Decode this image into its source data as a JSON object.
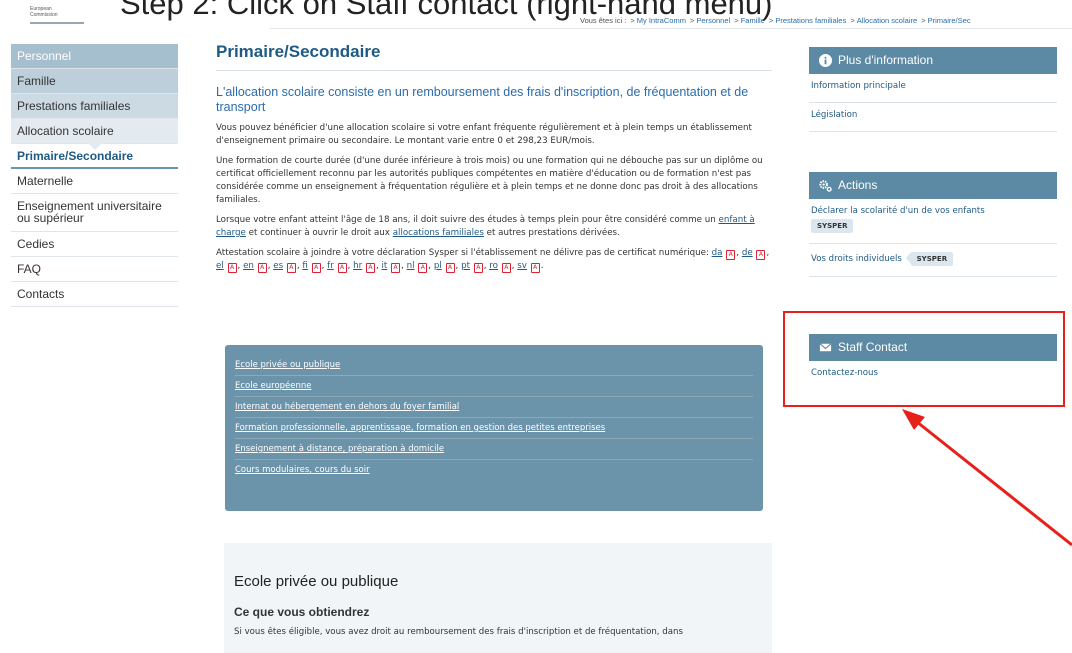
{
  "overlay_caption": "Step 2: Click on Staff contact (right-hand menu)",
  "logo": {
    "line1": "European",
    "line2": "Commission"
  },
  "breadcrumb": {
    "prefix": "Vous êtes ici :",
    "items": [
      "My IntraComm",
      "Personnel",
      "Famille",
      "Prestations familiales",
      "Allocation scolaire",
      "Primaire/Sec"
    ]
  },
  "sidebar": {
    "items": [
      {
        "label": "Personnel"
      },
      {
        "label": "Famille"
      },
      {
        "label": "Prestations familiales"
      },
      {
        "label": "Allocation scolaire"
      },
      {
        "label": "Primaire/Secondaire"
      },
      {
        "label": "Maternelle"
      },
      {
        "label": "Enseignement universitaire ou supérieur"
      },
      {
        "label": "Cedies"
      },
      {
        "label": "FAQ"
      },
      {
        "label": "Contacts"
      }
    ]
  },
  "main": {
    "title": "Primaire/Secondaire",
    "lead": "L'allocation scolaire consiste en un remboursement des frais d'inscription, de fréquentation et de transport",
    "p1": "Vous pouvez bénéficier d'une allocation scolaire si votre enfant fréquente régulièrement et à plein temps un établissement d'enseignement primaire ou secondaire. Le montant varie entre 0 et 298,23 EUR/mois.",
    "p2": "Une formation de courte durée (d'une durée inférieure à trois mois) ou une formation qui ne débouche pas sur un diplôme ou certificat officiellement reconnu par les autorités publiques compétentes en matière d'éducation ou de formation n'est pas considérée comme un enseignement à fréquentation régulière et à plein temps et ne donne donc pas droit à des allocations familiales.",
    "p3_a": "Lorsque votre enfant atteint l'âge de 18 ans, il doit suivre des études à temps plein pour être considéré comme un",
    "p3_link1": "enfant à charge",
    "p3_b": "et continuer à ouvrir le droit aux",
    "p3_link2": "allocations familiales",
    "p3_c": "et autres prestations dérivées.",
    "p4": "Attestation scolaire à joindre à votre déclaration Sysper si l'établissement ne délivre pas de certificat numérique:",
    "languages": [
      "da",
      "de",
      "el",
      "en",
      "es",
      "fi",
      "fr",
      "hr",
      "it",
      "nl",
      "pl",
      "pt",
      "ro",
      "sv"
    ],
    "pdf_glyph": "A"
  },
  "linkbox": [
    "Ecole privée ou publique",
    "Ecole européenne",
    "Internat ou hébergement en dehors du foyer familial",
    "Formation professionnelle, apprentissage, formation en gestion des petites entreprises",
    "Enseignement à distance, préparation à domicile",
    "Cours modulaires, cours du soir"
  ],
  "section": {
    "title": "Ecole privée ou publique",
    "subtitle": "Ce que vous obtiendrez",
    "text": "Si vous êtes éligible, vous avez droit au remboursement des frais d'inscription et de fréquentation, dans"
  },
  "panels": {
    "info": {
      "title": "Plus d'information",
      "links": [
        "Information principale",
        "Législation"
      ]
    },
    "actions": {
      "title": "Actions",
      "items": [
        {
          "label": "Déclarer la scolarité d'un de vos enfants",
          "tag": "SYSPER"
        },
        {
          "label": "Vos droits individuels",
          "tag": "SYSPER"
        }
      ]
    },
    "staff": {
      "title": "Staff Contact",
      "link": "Contactez-nous"
    }
  },
  "colors": {
    "accent": "#5c89a3",
    "highlight": "#e8201a",
    "link": "#1f5a85"
  }
}
